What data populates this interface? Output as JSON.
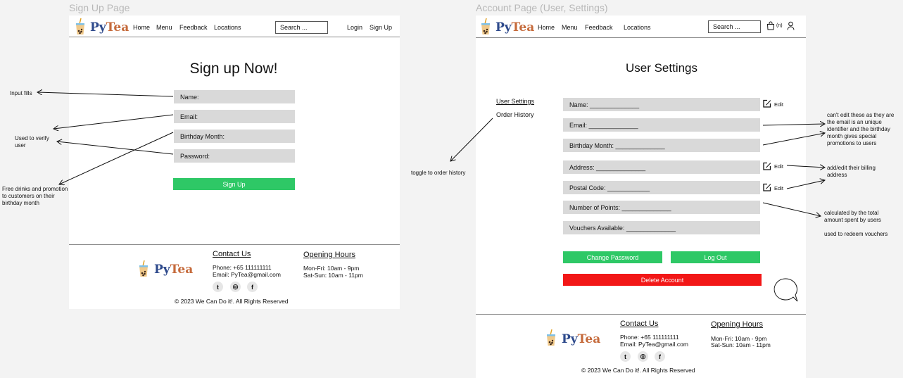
{
  "labels": {
    "signup_page": "Sign Up Page",
    "account_page": "Account Page (User, Settings)"
  },
  "brand": {
    "py": "Py",
    "tea": "Tea",
    "logo_icon": "bubble-tea-icon"
  },
  "nav": {
    "home": "Home",
    "menu": "Menu",
    "feedback": "Feedback",
    "locations": "Locations",
    "search_placeholder": "Search ...",
    "login": "Login",
    "signup": "Sign Up",
    "cart_count": "(n)",
    "cart_icon": "shopping-bag-icon",
    "user_icon": "user-icon"
  },
  "signup": {
    "title": "Sign up Now!",
    "fields": [
      "Name:",
      "Email:",
      "Birthday Month:",
      "Password:"
    ],
    "button": "Sign Up",
    "annotations": {
      "input_fills": "Input fills",
      "verify": "Used to verify user",
      "birthday": "Free drinks and promotion to customers on their birthday month"
    }
  },
  "account": {
    "title": "User Settings",
    "side_settings": "User Settings",
    "side_orders": "Order History",
    "fields": [
      "Name: ______________",
      "Email: ______________",
      "Birthday Month: ______________",
      "Address: ______________",
      "Postal Code: ____________",
      "Number of Points: ______________",
      "Vouchers Available: ______________"
    ],
    "edit": "Edit",
    "edit_icon": "edit-icon",
    "change_password": "Change Password",
    "log_out": "Log Out",
    "delete_account": "Delete Account",
    "chat_icon": "chat-bubble-icon",
    "annotations": {
      "toggle": "toggle to order history",
      "cant_edit": "can't edit these as they are the email is an unique identifier and the birthday month gives special promotions to users",
      "billing": "add/edit their billing address",
      "points": "calculated by the total amount spent by users",
      "vouchers": "used to redeem vouchers"
    }
  },
  "footer": {
    "contact_title": "Contact Us",
    "phone": "Phone: +65 111111111",
    "email": "Email: PyTea@gmail.com",
    "hours_title": "Opening Hours",
    "weekday": "Mon-Fri: 10am - 9pm",
    "weekend": "Sat-Sun: 10am - 11pm",
    "social_icons": [
      "twitter-icon",
      "instagram-icon",
      "facebook-icon"
    ],
    "copyright": "© 2023 We Can Do it!. All Rights Reserved"
  }
}
